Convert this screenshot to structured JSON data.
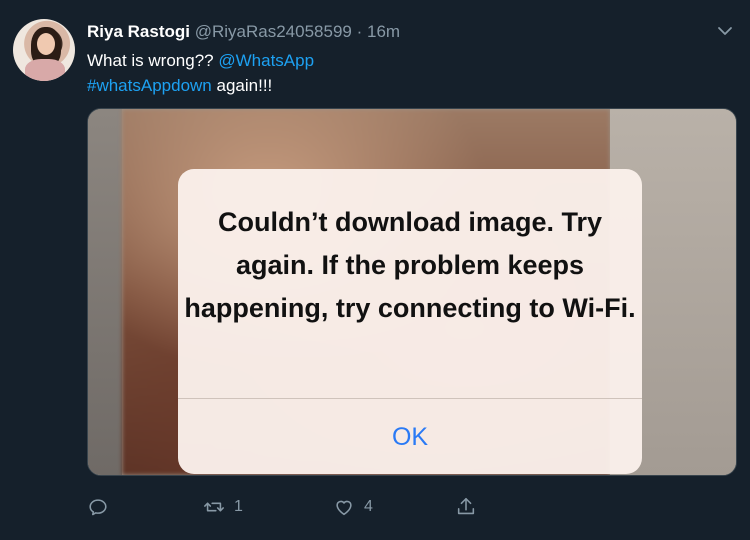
{
  "tweet": {
    "author_name": "Riya Rastogi",
    "author_handle": "@RiyaRas24058599",
    "separator": "·",
    "time": "16m",
    "text_plain_1": "What is wrong??",
    "mention": "@WhatsApp",
    "hashtag": "#whatsAppdown",
    "text_plain_2": "again!!!",
    "more_icon": "chevron-down-icon"
  },
  "media": {
    "alert_message": "Couldn’t download image. Try again. If the problem keeps happening, try connecting to Wi-Fi.",
    "alert_button": "OK"
  },
  "actions": {
    "reply_icon": "reply-icon",
    "retweet_icon": "retweet-icon",
    "retweet_count": "1",
    "like_icon": "heart-icon",
    "like_count": "4",
    "share_icon": "share-icon"
  },
  "colors": {
    "background": "#15202b",
    "link": "#1da1f2",
    "muted": "#8899a6",
    "ios_blue": "#2a7af5"
  }
}
